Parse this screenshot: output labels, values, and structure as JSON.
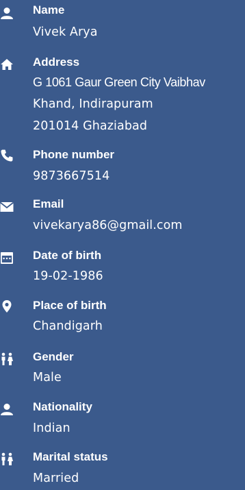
{
  "fields": [
    {
      "label": "Name",
      "value": "Vivek Arya",
      "icon": "person-icon"
    },
    {
      "label": "Address",
      "lines": [
        "G 1061 Gaur Green City Vaibhav",
        "Khand, Indirapuram",
        "201014 Ghaziabad"
      ],
      "icon": "home-icon"
    },
    {
      "label": "Phone number",
      "value": "9873667514",
      "icon": "phone-icon"
    },
    {
      "label": "Email",
      "value": "vivekarya86@gmail.com",
      "icon": "mail-icon"
    },
    {
      "label": "Date of birth",
      "value": "19-02-1986",
      "icon": "calendar-icon"
    },
    {
      "label": "Place of birth",
      "value": "Chandigarh",
      "icon": "location-pin-icon"
    },
    {
      "label": "Gender",
      "value": "Male",
      "icon": "gender-icon"
    },
    {
      "label": "Nationality",
      "value": "Indian",
      "icon": "person-icon"
    },
    {
      "label": "Marital status",
      "value": "Married",
      "icon": "couple-icon"
    }
  ],
  "colors": {
    "background": "#3b5a8c",
    "text": "#ffffff"
  }
}
